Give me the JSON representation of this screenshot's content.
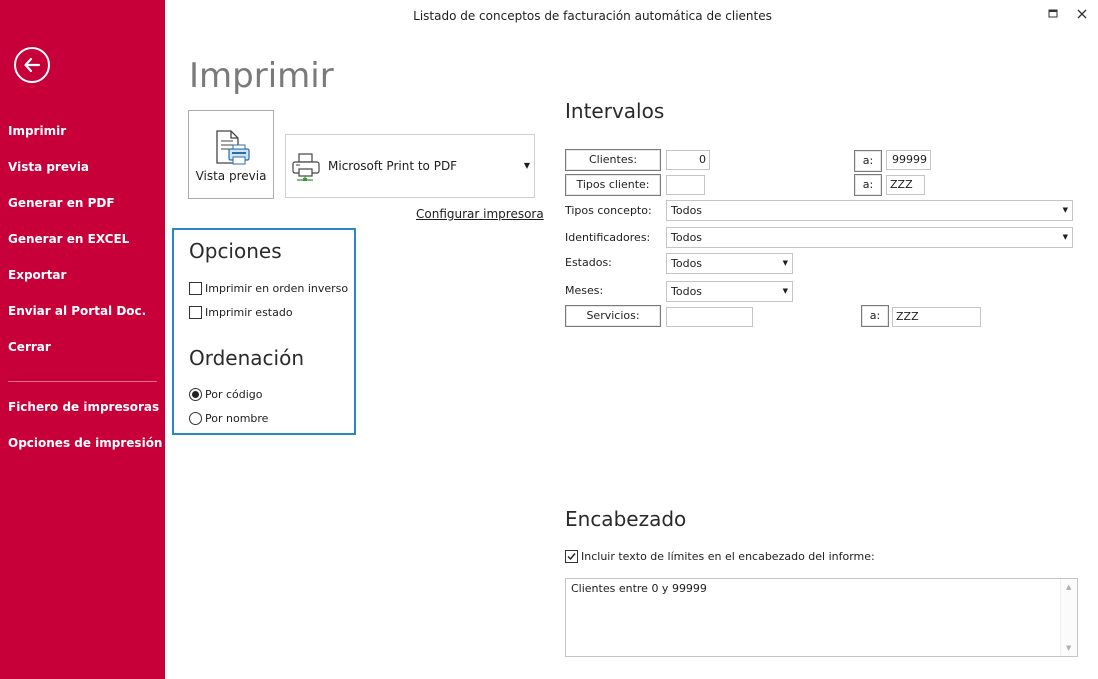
{
  "window": {
    "title": "Listado de conceptos de facturación automática de clientes"
  },
  "colors": {
    "sidebar": "#c8003a",
    "accent": "#2b86c4",
    "title_gray": "#7a7a7a"
  },
  "sidebar": {
    "back_icon": "arrow-left-icon",
    "items": [
      {
        "label": "Imprimir"
      },
      {
        "label": "Vista previa"
      },
      {
        "label": "Generar en PDF"
      },
      {
        "label": "Generar en EXCEL"
      },
      {
        "label": "Exportar"
      },
      {
        "label": "Enviar al Portal Doc."
      },
      {
        "label": "Cerrar"
      },
      {
        "label": "Fichero de impresoras"
      },
      {
        "label": "Opciones de impresión"
      }
    ]
  },
  "main": {
    "title": "Imprimir",
    "preview_button": "Vista previa",
    "printer": "Microsoft Print to PDF",
    "configure_link": "Configurar impresora"
  },
  "options": {
    "title": "Opciones",
    "checkboxes": [
      {
        "label": "Imprimir en orden inverso",
        "checked": false
      },
      {
        "label": "Imprimir estado",
        "checked": false
      }
    ],
    "ordering_title": "Ordenación",
    "radios": [
      {
        "label": "Por código",
        "selected": true
      },
      {
        "label": "Por nombre",
        "selected": false
      }
    ]
  },
  "intervals": {
    "title": "Intervalos",
    "clientes": {
      "label": "Clientes:",
      "from": "0",
      "to_label": "a:",
      "to": "99999"
    },
    "tipos_cliente": {
      "label": "Tipos cliente:",
      "from": "",
      "to_label": "a:",
      "to": "ZZZ"
    },
    "tipos_concepto": {
      "label": "Tipos concepto:",
      "value": "Todos"
    },
    "identificadores": {
      "label": "Identificadores:",
      "value": "Todos"
    },
    "estados": {
      "label": "Estados:",
      "value": "Todos"
    },
    "meses": {
      "label": "Meses:",
      "value": "Todos"
    },
    "servicios": {
      "label": "Servicios:",
      "from": "",
      "to_label": "a:",
      "to": "ZZZ"
    }
  },
  "header": {
    "title": "Encabezado",
    "include_label": "Incluir texto de límites en el encabezado del informe:",
    "include_checked": true,
    "text": "Clientes entre 0 y 99999"
  }
}
